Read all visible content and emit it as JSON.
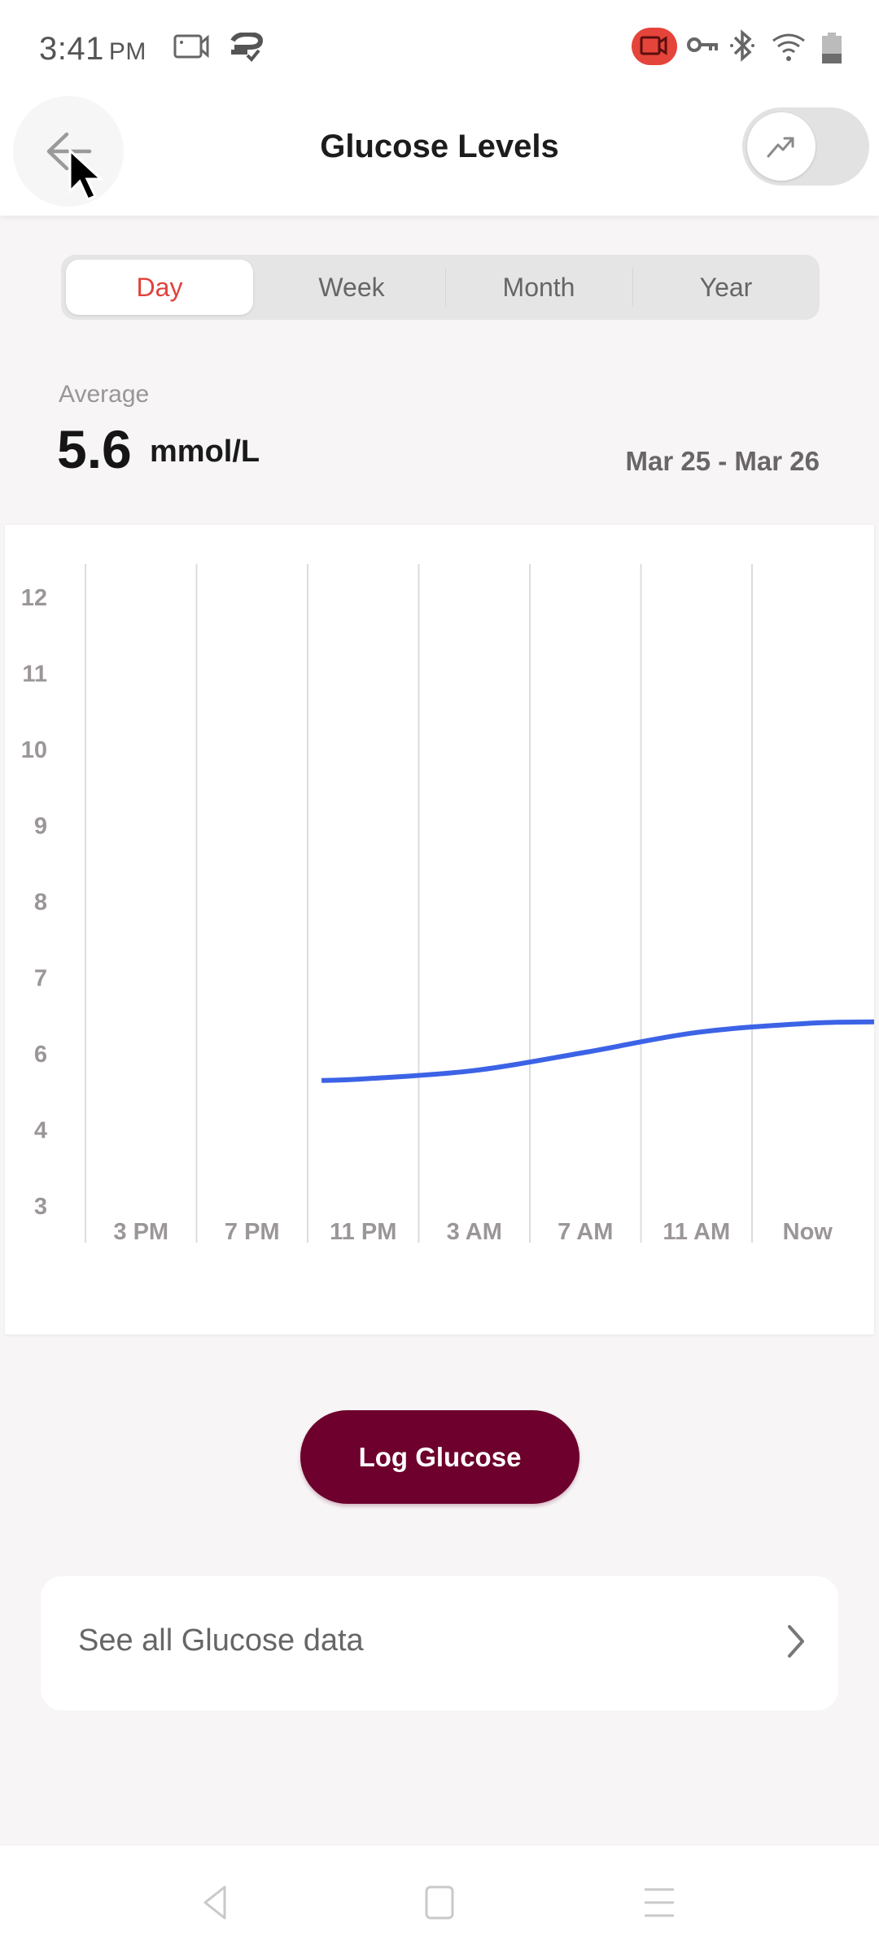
{
  "status_bar": {
    "time": "3:41",
    "ampm": "PM",
    "icons": [
      "screen-record-icon",
      "cloud-sync-icon",
      "recording-indicator-icon",
      "vpn-key-icon",
      "bluetooth-icon",
      "wifi-icon",
      "battery-icon"
    ],
    "recording_color": "#e5443a"
  },
  "header": {
    "title": "Glucose Levels",
    "back_icon": "arrow-left-icon",
    "trend_icon": "trend-up-icon"
  },
  "tabs": [
    {
      "label": "Day",
      "active": true
    },
    {
      "label": "Week",
      "active": false
    },
    {
      "label": "Month",
      "active": false
    },
    {
      "label": "Year",
      "active": false
    }
  ],
  "summary": {
    "average_label": "Average",
    "average_value": "5.6",
    "unit": "mmol/L",
    "date_range": "Mar 25 - Mar 26"
  },
  "chart_data": {
    "type": "line",
    "title": "",
    "xlabel": "",
    "ylabel": "",
    "y_tick_labels": [
      "12",
      "11",
      "10",
      "9",
      "8",
      "7",
      "6",
      "4",
      "3"
    ],
    "x_tick_labels": [
      "3 PM",
      "7 PM",
      "11 PM",
      "3 AM",
      "7 AM",
      "11 AM",
      "Now"
    ],
    "grid": "vertical",
    "series": [
      {
        "name": "Glucose",
        "color": "#3c63e6",
        "x_hours_from_3pm": [
          6.5,
          8,
          12,
          16,
          20,
          24,
          26.5
        ],
        "values": [
          5.65,
          5.67,
          5.78,
          6.02,
          6.28,
          6.4,
          6.42
        ]
      }
    ]
  },
  "actions": {
    "log_button": "Log Glucose",
    "log_color": "#6d002c",
    "see_all": "See all Glucose data"
  },
  "accent_color": "#e0423a",
  "nav": {
    "back": "nav-back-icon",
    "home": "nav-home-icon",
    "menu": "nav-menu-icon"
  }
}
